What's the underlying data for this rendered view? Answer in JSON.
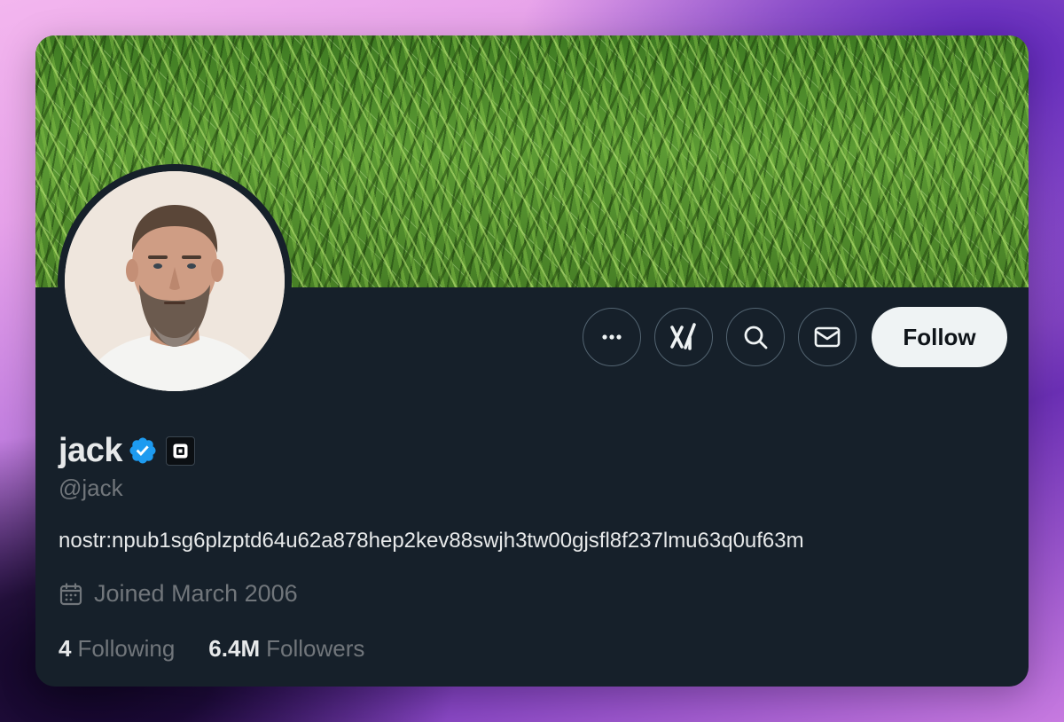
{
  "profile": {
    "display_name": "jack",
    "handle": "@jack",
    "bio": "nostr:npub1sg6plzptd64u62a878hep2kev88swjh3tw00gjsfl8f237lmu63q0uf63m",
    "joined": "Joined March 2006",
    "verified_icon": "verified-badge-icon",
    "affiliation_icon": "square-logo-icon"
  },
  "actions": {
    "more_icon": "more-icon",
    "grok_icon": "grok-icon",
    "search_icon": "search-icon",
    "message_icon": "message-icon",
    "follow_label": "Follow"
  },
  "stats": {
    "following_count": "4",
    "following_label": "Following",
    "followers_count": "6.4M",
    "followers_label": "Followers"
  },
  "colors": {
    "card_background": "#16202a",
    "verified_blue": "#1d9bf0",
    "muted_text": "#71767b",
    "primary_text": "#e7e9ea",
    "follow_button_bg": "#eff3f4"
  }
}
